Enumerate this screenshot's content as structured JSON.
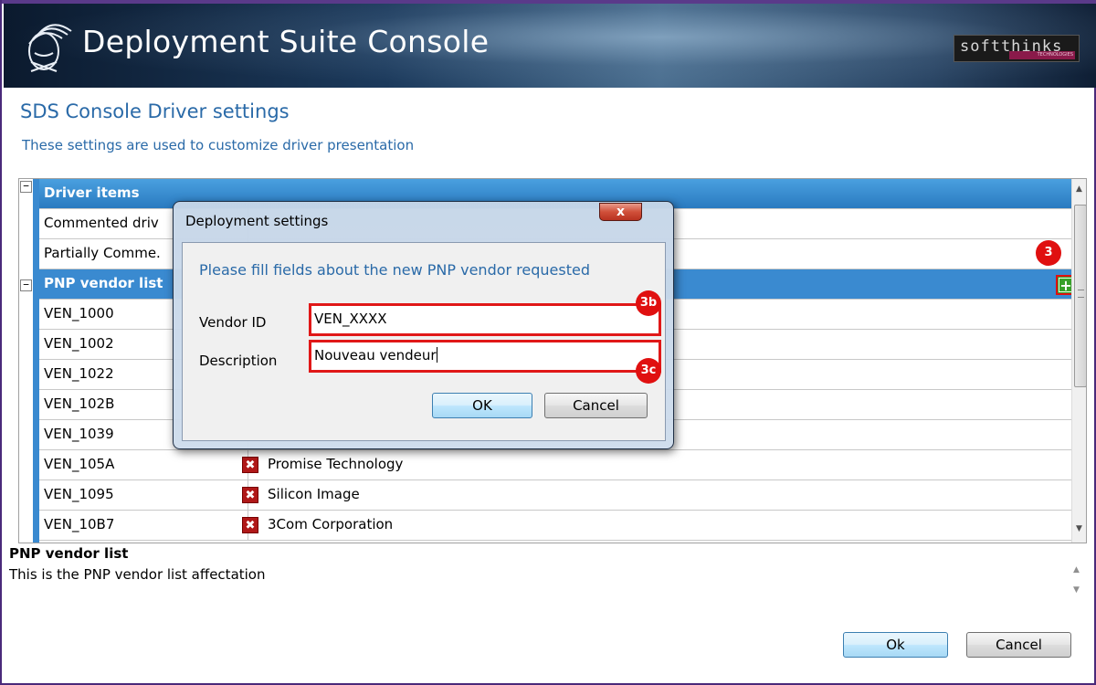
{
  "window": {
    "app_title": "Deployment Suite Console",
    "brand": "softthinks",
    "brand_sub": "TECHNOLOGIES"
  },
  "page": {
    "title": "SDS Console Driver settings",
    "subtitle": "These settings are used to customize driver presentation"
  },
  "grid": {
    "categories": {
      "driver_items": "Driver items",
      "pnp_vendor_list": "PNP vendor list"
    },
    "driver_items": [
      {
        "name": "Commented driv"
      },
      {
        "name": "Partially Comme."
      }
    ],
    "vendors": [
      {
        "id": "VEN_1000",
        "name": ""
      },
      {
        "id": "VEN_1002",
        "name": ""
      },
      {
        "id": "VEN_1022",
        "name": ""
      },
      {
        "id": "VEN_102B",
        "name": ""
      },
      {
        "id": "VEN_1039",
        "name": ""
      },
      {
        "id": "VEN_105A",
        "name": "Promise Technology"
      },
      {
        "id": "VEN_1095",
        "name": "Silicon Image"
      },
      {
        "id": "VEN_10B7",
        "name": "3Com Corporation"
      }
    ],
    "delete_glyph": "✖",
    "add_glyph": "+",
    "collapse_glyph": "−"
  },
  "description": {
    "title": "PNP vendor list",
    "text": "This is the PNP vendor list affectation"
  },
  "buttons": {
    "ok": "Ok",
    "cancel": "Cancel"
  },
  "dialog": {
    "title": "Deployment settings",
    "close": "x",
    "message": "Please fill fields about the new PNP vendor requested",
    "vendor_id_label": "Vendor ID",
    "vendor_id_value": "VEN_XXXX",
    "description_label": "Description",
    "description_value": "Nouveau vendeur",
    "ok": "OK",
    "cancel": "Cancel"
  },
  "annotations": {
    "badge_add": "3",
    "badge_vendor_id": "3b",
    "badge_description": "3c"
  },
  "colors": {
    "accent_blue": "#3a8ad0",
    "title_blue": "#2a6aa8",
    "annotation_red": "#e01010"
  }
}
